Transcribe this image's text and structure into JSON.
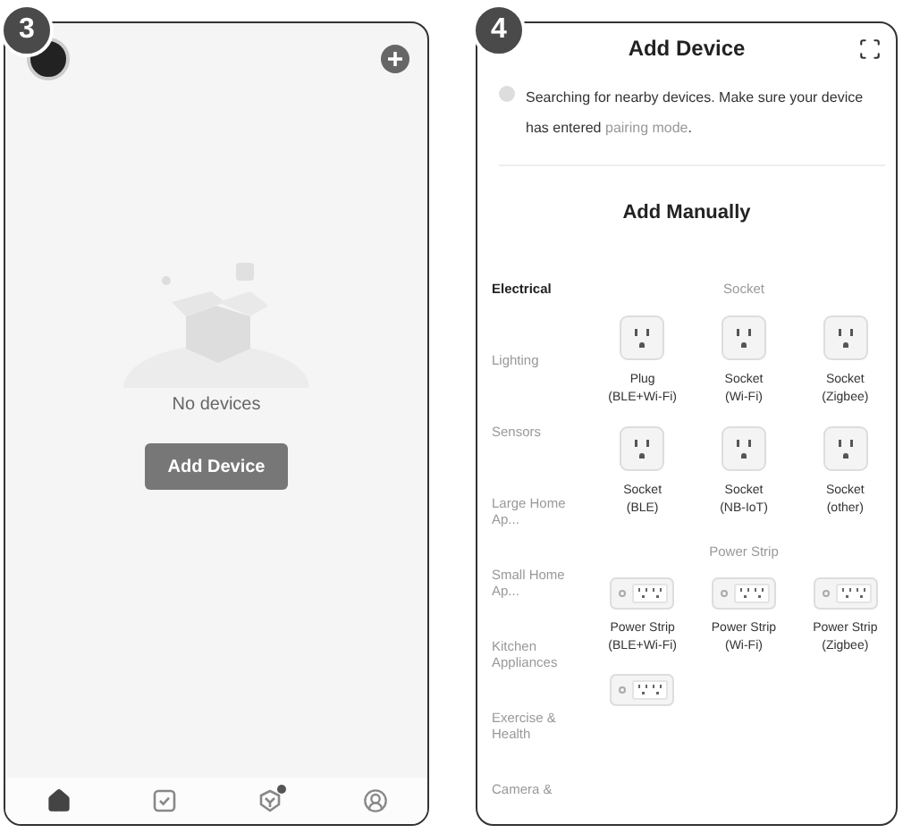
{
  "home_screen": {
    "badge": "3",
    "empty_text": "No devices",
    "button": "Add Device",
    "tabs": [
      {
        "selected": true,
        "dot": false
      },
      {
        "selected": false,
        "dot": false
      },
      {
        "selected": false,
        "dot": true
      },
      {
        "selected": false,
        "dot": false
      }
    ]
  },
  "add_screen": {
    "badge": "4",
    "title": "Add Device",
    "search_text": "Searching for nearby devices. Make sure your device has entered",
    "link": "pairing mode",
    "search_end": ".",
    "section_title": "Add Manually",
    "categories": [
      {
        "label": "Electrical",
        "selected": true
      },
      {
        "label": "Lighting",
        "selected": false
      },
      {
        "label": "Sensors",
        "selected": false
      },
      {
        "label": "Large Home Ap...",
        "selected": false
      },
      {
        "label": "Small Home Ap...",
        "selected": false
      },
      {
        "label": "Kitchen Appliances",
        "selected": false
      },
      {
        "label": "Exercise & Health",
        "selected": false
      },
      {
        "label": "Camera &",
        "selected": false
      }
    ],
    "groups": [
      {
        "title": "Socket",
        "devices": [
          {
            "kind": "socket",
            "name": "Plug",
            "detail": "(BLE+Wi-Fi)"
          },
          {
            "kind": "socket",
            "name": "Socket",
            "detail": "(Wi-Fi)"
          },
          {
            "kind": "socket",
            "name": "Socket",
            "detail": "(Zigbee)"
          },
          {
            "kind": "socket",
            "name": "Socket",
            "detail": "(BLE)"
          },
          {
            "kind": "socket",
            "name": "Socket",
            "detail": "(NB-IoT)"
          },
          {
            "kind": "socket",
            "name": "Socket",
            "detail": "(other)"
          }
        ]
      },
      {
        "title": "Power Strip",
        "devices": [
          {
            "kind": "strip",
            "name": "Power Strip",
            "detail": "(BLE+Wi-Fi)"
          },
          {
            "kind": "strip",
            "name": "Power Strip",
            "detail": "(Wi-Fi)"
          },
          {
            "kind": "strip",
            "name": "Power Strip",
            "detail": "(Zigbee)"
          },
          {
            "kind": "strip"
          }
        ]
      }
    ]
  }
}
